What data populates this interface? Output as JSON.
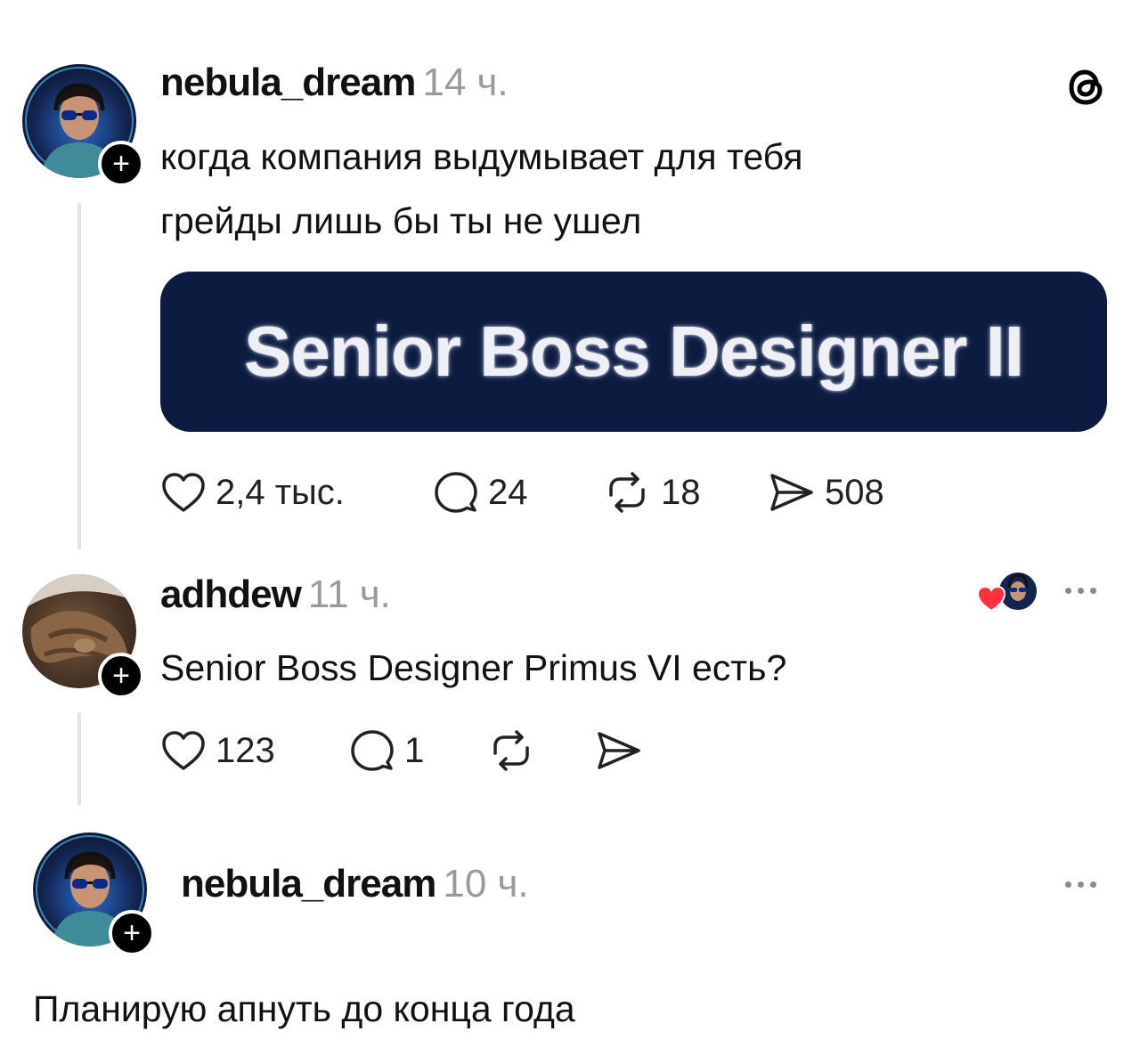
{
  "post": {
    "username": "nebula_dream",
    "time": "14 ч.",
    "text_line1": "когда компания выдумывает для тебя",
    "text_line2": "грейды лишь бы ты не ушел",
    "image_text": "Senior Boss Designer II",
    "likes": "2,4 тыс.",
    "comments": "24",
    "reposts": "18",
    "shares": "508"
  },
  "reply": {
    "username": "adhdew",
    "time": "11 ч.",
    "text": "Senior Boss Designer Primus VI есть?",
    "likes": "123",
    "comments": "1"
  },
  "reply2": {
    "username": "nebula_dream",
    "time": "10 ч.",
    "text": "Планирую апнуть до конца года"
  },
  "icons": {
    "threads": "threads-logo-icon",
    "like": "heart-icon",
    "comment": "comment-bubble-icon",
    "repost": "repost-icon",
    "share": "send-icon",
    "more": "more-dots-icon",
    "follow": "plus-icon"
  },
  "colors": {
    "banner_bg": "#0c1b3f",
    "liked_heart": "#ff3040",
    "thread_line": "#e4e4e4",
    "muted": "#9a9a9a"
  }
}
